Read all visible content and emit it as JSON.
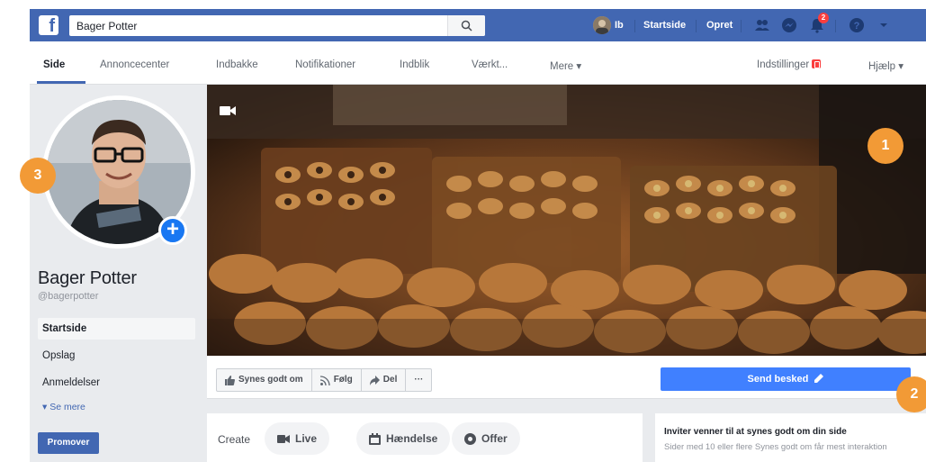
{
  "topbar": {
    "search_text": "Bager Potter",
    "user_label": "Ib",
    "home_label": "Startside",
    "create_label": "Opret",
    "notification_count": "2",
    "brand_color": "#4267b2"
  },
  "subnav": {
    "items": [
      "Side",
      "Annoncecenter",
      "Indbakke",
      "Notifikationer",
      "Indblik",
      "Værkt...",
      "Mere ▾"
    ],
    "settings_label": "Indstillinger",
    "help_label": "Hjælp ▾"
  },
  "profile": {
    "name": "Bager Potter",
    "handle": "@bagerpotter"
  },
  "sidebar": {
    "items": [
      "Startside",
      "Opslag",
      "Anmeldelser"
    ],
    "see_more": "Se mere",
    "promote": "Promover"
  },
  "actions": {
    "like": "Synes godt om",
    "follow": "Følg",
    "share": "Del",
    "more": "···",
    "send_message": "Send besked"
  },
  "create": {
    "label": "Create",
    "live": "Live",
    "event": "Hændelse",
    "offer": "Offer"
  },
  "invite": {
    "title": "Inviter venner til at synes godt om din side",
    "description": "Sider med 10 eller flere Synes godt om får mest interaktion"
  },
  "callouts": [
    "1",
    "2",
    "3"
  ],
  "colors": {
    "callout": "#f29a36",
    "send_button": "#4080ff"
  }
}
